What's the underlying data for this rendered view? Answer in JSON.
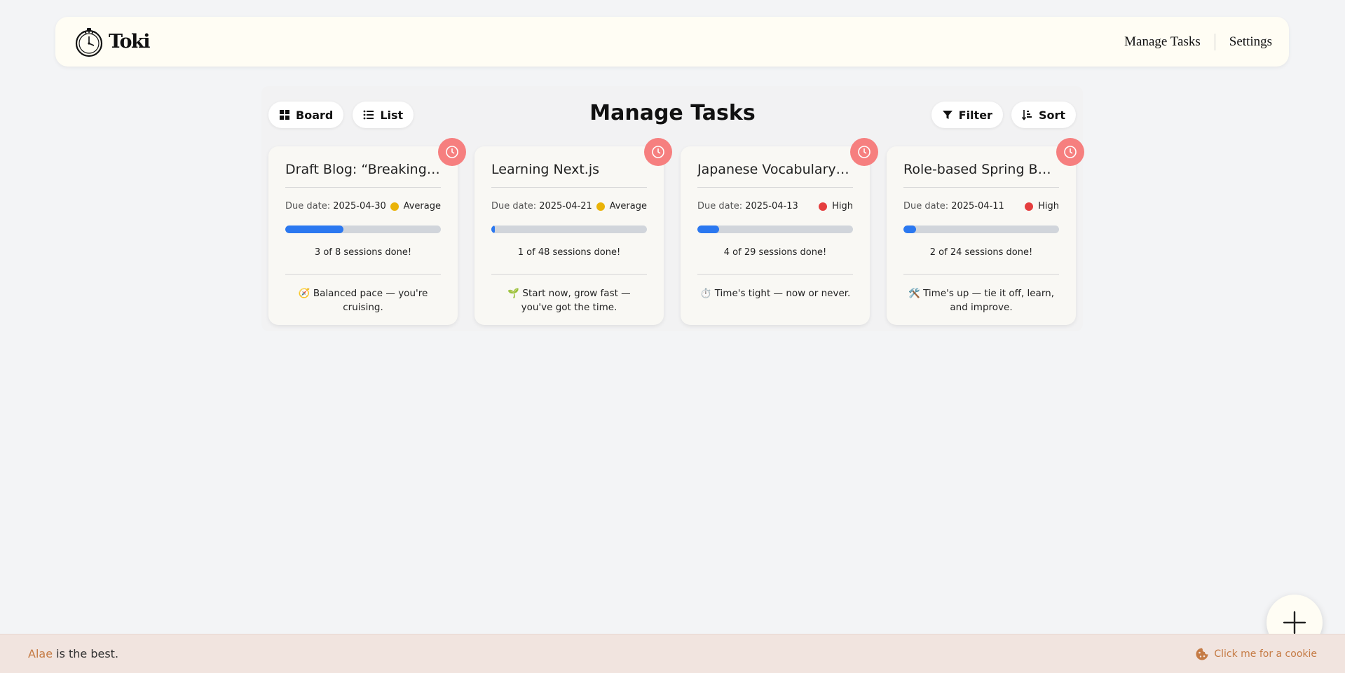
{
  "header": {
    "brand": "Toki",
    "nav": {
      "manage_tasks": "Manage Tasks",
      "settings": "Settings"
    }
  },
  "toolbar": {
    "board_label": "Board",
    "list_label": "List",
    "title": "Manage Tasks",
    "filter_label": "Filter",
    "sort_label": "Sort"
  },
  "colors": {
    "high": "#e53e3e",
    "average": "#eab308",
    "progress": "#2b78f0",
    "timer": "#f67f7f",
    "accent": "#c57b45"
  },
  "tasks": [
    {
      "title": "Draft Blog: “Breaking…",
      "due_label": "Due date:",
      "due_date": "2025-04-30",
      "priority": "Average",
      "priority_color": "#eab308",
      "sessions_done": 3,
      "sessions_total": 8,
      "progress": 0.375,
      "sessions_text": "3 of 8 sessions done!",
      "quote": "🧭 Balanced pace — you're cruising."
    },
    {
      "title": "Learning Next.js",
      "due_label": "Due date:",
      "due_date": "2025-04-21",
      "priority": "Average",
      "priority_color": "#eab308",
      "sessions_done": 1,
      "sessions_total": 48,
      "progress": 0.0208,
      "sessions_text": "1 of 48 sessions done!",
      "quote": "🌱 Start now, grow fast — you've got the time."
    },
    {
      "title": "Japanese Vocabulary …",
      "due_label": "Due date:",
      "due_date": "2025-04-13",
      "priority": "High",
      "priority_color": "#e53e3e",
      "sessions_done": 4,
      "sessions_total": 29,
      "progress": 0.138,
      "sessions_text": "4 of 29 sessions done!",
      "quote": "⏱️ Time's tight — now or never."
    },
    {
      "title": "Role-based Spring Bo…",
      "due_label": "Due date:",
      "due_date": "2025-04-11",
      "priority": "High",
      "priority_color": "#e53e3e",
      "sessions_done": 2,
      "sessions_total": 24,
      "progress": 0.083,
      "sessions_text": "2 of 24 sessions done!",
      "quote": "🛠️ Time's up — tie it off, learn, and improve."
    }
  ],
  "footer": {
    "name": "Alae",
    "text": " is the best.",
    "cookie_label": "Click me for a cookie"
  }
}
